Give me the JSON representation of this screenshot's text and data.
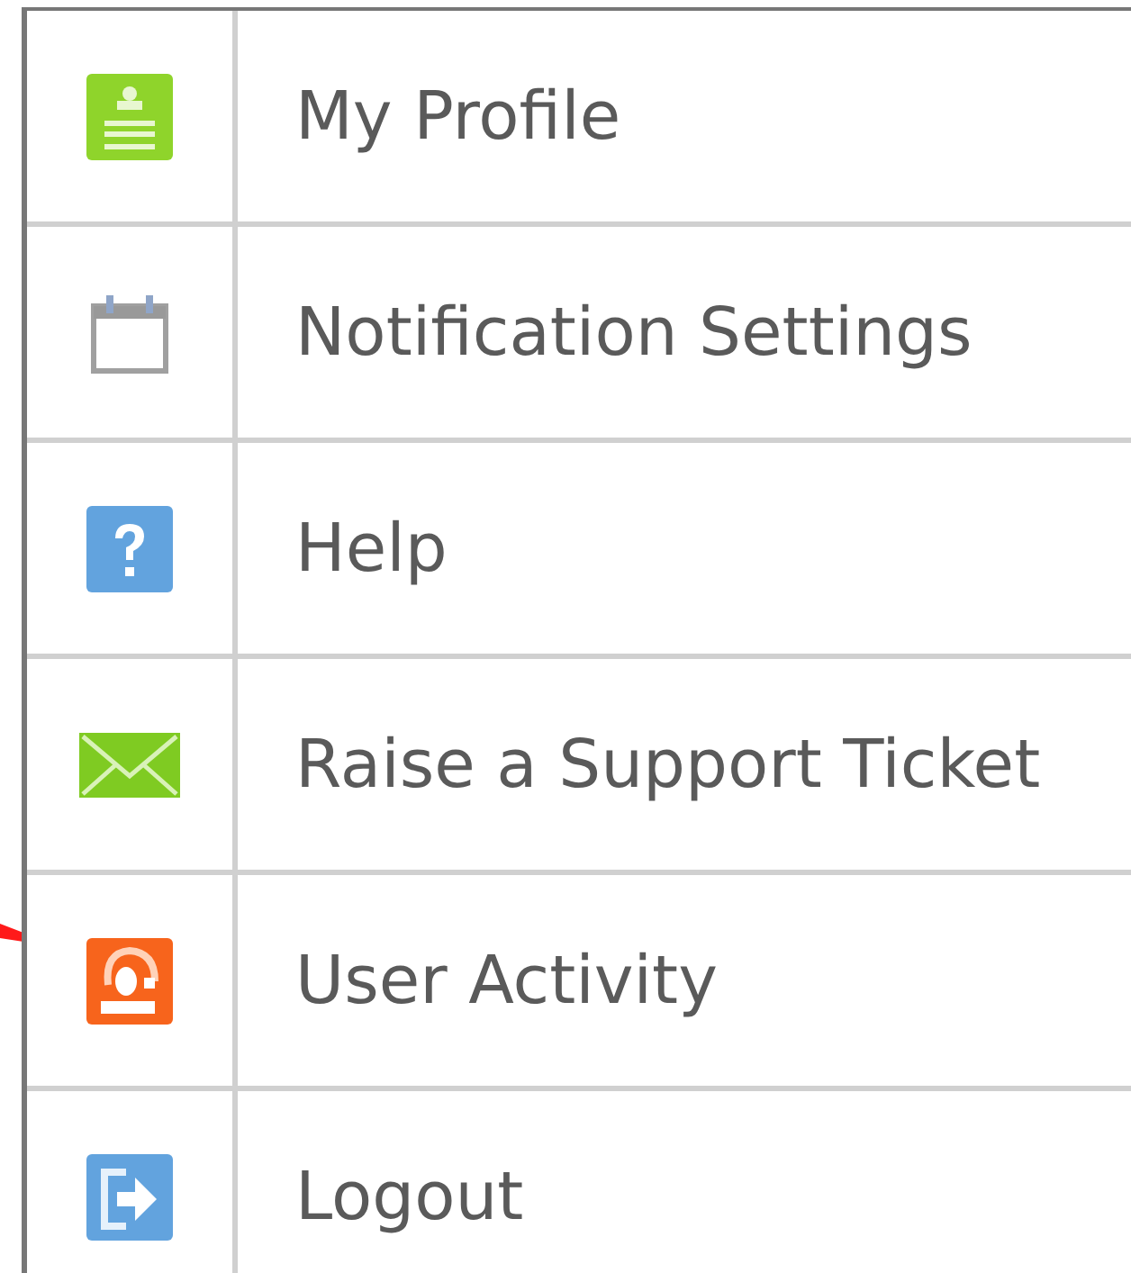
{
  "menu": {
    "items": [
      {
        "label": "My Profile"
      },
      {
        "label": "Notification Settings"
      },
      {
        "label": "Help"
      },
      {
        "label": "Raise a Support Ticket"
      },
      {
        "label": "User Activity"
      },
      {
        "label": "Logout"
      }
    ]
  }
}
